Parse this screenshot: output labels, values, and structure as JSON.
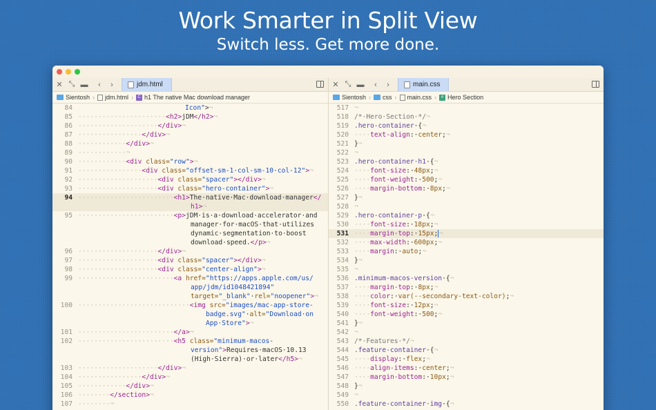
{
  "promo": {
    "headline": "Work Smarter in Split View",
    "subline": "Switch less. Get more done."
  },
  "left_pane": {
    "tab_label": "jdm.html",
    "breadcrumb": [
      "Sientosh",
      "jdm.html",
      "h1 The native Mac download manager"
    ],
    "lines": [
      {
        "n": "84",
        "dots": "",
        "html": "<span class='str'>Icon\"</span>&gt;<span class='dot'>¬</span>",
        "indentPx": 160
      },
      {
        "n": "85",
        "dots": "······················",
        "html": "<span class='tag'>&lt;h2&gt;</span>jDM<span class='tag'>&lt;/h2&gt;</span><span class='dot'>¬</span>"
      },
      {
        "n": "86",
        "dots": "····················",
        "html": "<span class='tag'>&lt;/div&gt;</span><span class='dot'>¬</span>"
      },
      {
        "n": "87",
        "dots": "················",
        "html": "<span class='tag'>&lt;/div&gt;</span><span class='dot'>¬</span>"
      },
      {
        "n": "88",
        "dots": "············",
        "html": "<span class='tag'>&lt;/div&gt;</span><span class='dot'>¬</span>"
      },
      {
        "n": "89",
        "dots": "············",
        "html": "<span class='dot'>¬</span>"
      },
      {
        "n": "90",
        "dots": "············",
        "html": "<span class='tag'>&lt;div</span> <span class='attr'>class=</span><span class='str'>\"row\"</span><span class='tag'>&gt;</span><span class='dot'>¬</span>"
      },
      {
        "n": "91",
        "dots": "················",
        "html": "<span class='tag'>&lt;div</span> <span class='attr'>class=</span><span class='str'>\"offset-sm-1·col-sm-10·col-12\"</span><span class='tag'>&gt;</span><span class='dot'>¬</span>"
      },
      {
        "n": "92",
        "dots": "····················",
        "html": "<span class='tag'>&lt;div</span> <span class='attr'>class=</span><span class='str'>\"spacer\"</span><span class='tag'>&gt;&lt;/div&gt;</span><span class='dot'>¬</span>"
      },
      {
        "n": "93",
        "dots": "····················",
        "html": "<span class='tag'>&lt;div</span> <span class='attr'>class=</span><span class='str'>\"hero-container\"</span><span class='tag'>&gt;</span><span class='dot'>¬</span>"
      },
      {
        "n": "94",
        "active": true,
        "dots": "························",
        "html": "<span class='tag'>&lt;h1&gt;</span>The·native·Mac·download·manager<span class='tag'>&lt;/</span>"
      },
      {
        "n": "",
        "dots": "",
        "html": "<span class='tag'>h1&gt;</span><span class='dot'>¬</span>",
        "indentPx": 168,
        "active": true
      },
      {
        "n": "95",
        "dots": "························",
        "html": "<span class='tag'>&lt;p&gt;</span>jDM·is·a·download·accelerator·and"
      },
      {
        "n": "",
        "dots": "",
        "html": "manager·for·macOS·that·utilizes",
        "indentPx": 168
      },
      {
        "n": "",
        "dots": "",
        "html": "dynamic·segmentation·to·boost",
        "indentPx": 168
      },
      {
        "n": "",
        "dots": "",
        "html": "download·speed.<span class='tag'>&lt;/p&gt;</span><span class='dot'>¬</span>",
        "indentPx": 168
      },
      {
        "n": "96",
        "dots": "····················",
        "html": "<span class='tag'>&lt;/div&gt;</span><span class='dot'>¬</span>"
      },
      {
        "n": "97",
        "dots": "····················",
        "html": "<span class='tag'>&lt;div</span> <span class='attr'>class=</span><span class='str'>\"spacer\"</span><span class='tag'>&gt;&lt;/div&gt;</span><span class='dot'>¬</span>"
      },
      {
        "n": "98",
        "dots": "····················",
        "html": "<span class='tag'>&lt;div</span> <span class='attr'>class=</span><span class='str'>\"center-align\"</span><span class='tag'>&gt;</span><span class='dot'>¬</span>"
      },
      {
        "n": "99",
        "dots": "························",
        "html": "<span class='tag'>&lt;a</span> <span class='attr'>href=</span><span class='str'>\"https://apps.apple.com/us/</span>"
      },
      {
        "n": "",
        "dots": "",
        "html": "<span class='str'>app/jdm/id1048421894\"</span>",
        "indentPx": 168
      },
      {
        "n": "",
        "dots": "",
        "html": "<span class='attr'>target=</span><span class='str'>\"_blank\"</span>·<span class='attr'>rel=</span><span class='str'>\"noopener\"</span><span class='tag'>&gt;</span><span class='dot'>¬</span>",
        "indentPx": 168
      },
      {
        "n": "100",
        "dots": "····························",
        "html": "<span class='tag'>&lt;img</span> <span class='attr'>src=</span><span class='str'>\"images/mac-app-store-</span>"
      },
      {
        "n": "",
        "dots": "",
        "html": "<span class='str'>badge.svg\"</span>·<span class='attr'>alt=</span><span class='str'>\"Download·on</span>",
        "indentPx": 190
      },
      {
        "n": "",
        "dots": "",
        "html": "<span class='str'>App·Store\"</span><span class='tag'>&gt;</span><span class='dot'>¬</span>",
        "indentPx": 190
      },
      {
        "n": "101",
        "dots": "························",
        "html": "<span class='tag'>&lt;/a&gt;</span><span class='dot'>¬</span>"
      },
      {
        "n": "102",
        "dots": "························",
        "html": "<span class='tag'>&lt;h5</span> <span class='attr'>class=</span><span class='str'>\"minimum-macos-</span>"
      },
      {
        "n": "",
        "dots": "",
        "html": "<span class='str'>version\"</span><span class='tag'>&gt;</span>Requires·macOS·10.13",
        "indentPx": 168
      },
      {
        "n": "",
        "dots": "",
        "html": "(High·Sierra)·or·later<span class='tag'>&lt;/h5&gt;</span><span class='dot'>¬</span>",
        "indentPx": 168
      },
      {
        "n": "103",
        "dots": "····················",
        "html": "<span class='tag'>&lt;/div&gt;</span><span class='dot'>¬</span>"
      },
      {
        "n": "104",
        "dots": "················",
        "html": "<span class='tag'>&lt;/div&gt;</span><span class='dot'>¬</span>"
      },
      {
        "n": "105",
        "dots": "············",
        "html": "<span class='tag'>&lt;/div&gt;</span><span class='dot'>¬</span>"
      },
      {
        "n": "106",
        "dots": "········",
        "html": "<span class='tag'>&lt;/section&gt;</span><span class='dot'>¬</span>"
      },
      {
        "n": "107",
        "dots": "········",
        "html": "<span class='dot'>¬</span>"
      }
    ]
  },
  "right_pane": {
    "tab_label": "main.css",
    "breadcrumb": [
      "Sientosh",
      "css",
      "main.css",
      "Hero Section"
    ],
    "lines": [
      {
        "n": "517",
        "dots": "",
        "html": "<span class='dot'>¬</span>"
      },
      {
        "n": "518",
        "dots": "",
        "html": "<span class='cm'>/*·Hero·Section·*/</span><span class='dot'>¬</span>"
      },
      {
        "n": "519",
        "dots": "",
        "html": "<span class='sel'>.hero-container</span>·{<span class='dot'>¬</span>"
      },
      {
        "n": "520",
        "dots": "····",
        "html": "<span class='prop'>text-align</span>:·<span class='val'>center</span>;<span class='dot'>¬</span>"
      },
      {
        "n": "521",
        "dots": "",
        "html": "}<span class='dot'>¬</span>"
      },
      {
        "n": "522",
        "dots": "",
        "html": "<span class='dot'>¬</span>"
      },
      {
        "n": "523",
        "dots": "",
        "html": "<span class='sel'>.hero-container·h1</span>·{<span class='dot'>¬</span>"
      },
      {
        "n": "524",
        "dots": "····",
        "html": "<span class='prop'>font-size</span>:·<span class='val'>48px</span>;<span class='dot'>¬</span>"
      },
      {
        "n": "525",
        "dots": "····",
        "html": "<span class='prop'>font-weight</span>:·<span class='val'>500</span>;<span class='dot'>¬</span>"
      },
      {
        "n": "526",
        "dots": "····",
        "html": "<span class='prop'>margin-bottom</span>:·<span class='val'>8px</span>;<span class='dot'>¬</span>"
      },
      {
        "n": "527",
        "dots": "",
        "html": "}<span class='dot'>¬</span>"
      },
      {
        "n": "528",
        "dots": "",
        "html": "<span class='dot'>¬</span>"
      },
      {
        "n": "529",
        "dots": "",
        "html": "<span class='sel'>.hero-container·p</span>·{<span class='dot'>¬</span>"
      },
      {
        "n": "530",
        "dots": "····",
        "html": "<span class='prop'>font-size</span>:·<span class='val'>18px</span>;<span class='dot'>¬</span>"
      },
      {
        "n": "531",
        "active": true,
        "dots": "····",
        "html": "<span class='prop'>margin-top</span>:·<span class='val'>15px</span>;<span class='caret'></span><span class='dot'>¬</span>"
      },
      {
        "n": "532",
        "dots": "····",
        "html": "<span class='prop'>max-width</span>:·<span class='val'>600px</span>;<span class='dot'>¬</span>"
      },
      {
        "n": "533",
        "dots": "····",
        "html": "<span class='prop'>margin</span>:·<span class='val'>auto</span>;<span class='dot'>¬</span>"
      },
      {
        "n": "534",
        "dots": "",
        "html": "}<span class='dot'>¬</span>"
      },
      {
        "n": "535",
        "dots": "",
        "html": "<span class='dot'>¬</span>"
      },
      {
        "n": "536",
        "dots": "",
        "html": "<span class='sel'>.minimum-macos-version</span>·{<span class='dot'>¬</span>"
      },
      {
        "n": "537",
        "dots": "····",
        "html": "<span class='prop'>margin-top</span>:·<span class='val'>8px</span>;<span class='dot'>¬</span>"
      },
      {
        "n": "538",
        "dots": "····",
        "html": "<span class='prop'>color</span>:·<span class='val'>var(--secondary-text-color)</span>;<span class='dot'>¬</span>"
      },
      {
        "n": "539",
        "dots": "····",
        "html": "<span class='prop'>font-size</span>:·<span class='val'>12px</span>;<span class='dot'>¬</span>"
      },
      {
        "n": "540",
        "dots": "····",
        "html": "<span class='prop'>font-weight</span>:·<span class='val'>500</span>;<span class='dot'>¬</span>"
      },
      {
        "n": "541",
        "dots": "",
        "html": "}<span class='dot'>¬</span>"
      },
      {
        "n": "542",
        "dots": "",
        "html": "<span class='dot'>¬</span>"
      },
      {
        "n": "543",
        "dots": "",
        "html": "<span class='cm'>/*·Features·*/</span><span class='dot'>¬</span>"
      },
      {
        "n": "544",
        "dots": "",
        "html": "<span class='sel'>.feature-container</span>·{<span class='dot'>¬</span>"
      },
      {
        "n": "545",
        "dots": "····",
        "html": "<span class='prop'>display</span>:·<span class='val'>flex</span>;<span class='dot'>¬</span>"
      },
      {
        "n": "546",
        "dots": "····",
        "html": "<span class='prop'>align-items</span>:·<span class='val'>center</span>;<span class='dot'>¬</span>"
      },
      {
        "n": "547",
        "dots": "····",
        "html": "<span class='prop'>margin-bottom</span>:·<span class='val'>10px</span>;<span class='dot'>¬</span>"
      },
      {
        "n": "548",
        "dots": "",
        "html": "}<span class='dot'>¬</span>"
      },
      {
        "n": "549",
        "dots": "",
        "html": "<span class='dot'>¬</span>"
      },
      {
        "n": "550",
        "dots": "",
        "html": "<span class='sel'>.feature-container·img</span>·{<span class='dot'>¬</span>"
      }
    ]
  }
}
